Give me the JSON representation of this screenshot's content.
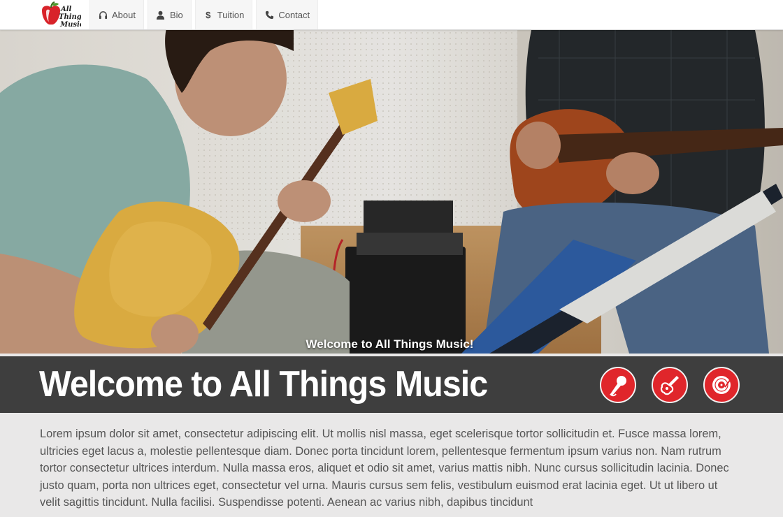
{
  "brand": {
    "logo_text": [
      "All",
      "Things",
      "Music"
    ]
  },
  "nav": {
    "items": [
      {
        "label": "About",
        "icon": "headphones-icon"
      },
      {
        "label": "Bio",
        "icon": "user-icon"
      },
      {
        "label": "Tuition",
        "icon": "dollar-icon"
      },
      {
        "label": "Contact",
        "icon": "phone-icon"
      }
    ]
  },
  "hero": {
    "caption": "Welcome to All Things Music!",
    "slides": 3,
    "active_slide": 1
  },
  "banner": {
    "title": "Welcome to All Things Music",
    "icons": [
      "microphone-icon",
      "guitar-icon",
      "vinyl-record-icon"
    ],
    "accent_color": "#e0262b"
  },
  "content": {
    "paragraph": "Lorem ipsum dolor sit amet, consectetur adipiscing elit. Ut mollis nisl massa, eget scelerisque tortor sollicitudin et. Fusce massa lorem, ultricies eget lacus a, molestie pellentesque diam. Donec porta tincidunt lorem, pellentesque fermentum ipsum varius non. Nam rutrum tortor consectetur ultrices interdum. Nulla massa eros, aliquet et odio sit amet, varius mattis nibh. Nunc cursus sollicitudin lacinia. Donec justo quam, porta non ultrices eget, consectetur vel urna. Mauris cursus sem felis, vestibulum euismod erat lacinia eget. Ut ut libero ut velit sagittis tincidunt. Nulla facilisi. Suspendisse potenti. Aenean ac varius nibh, dapibus tincidunt"
  }
}
